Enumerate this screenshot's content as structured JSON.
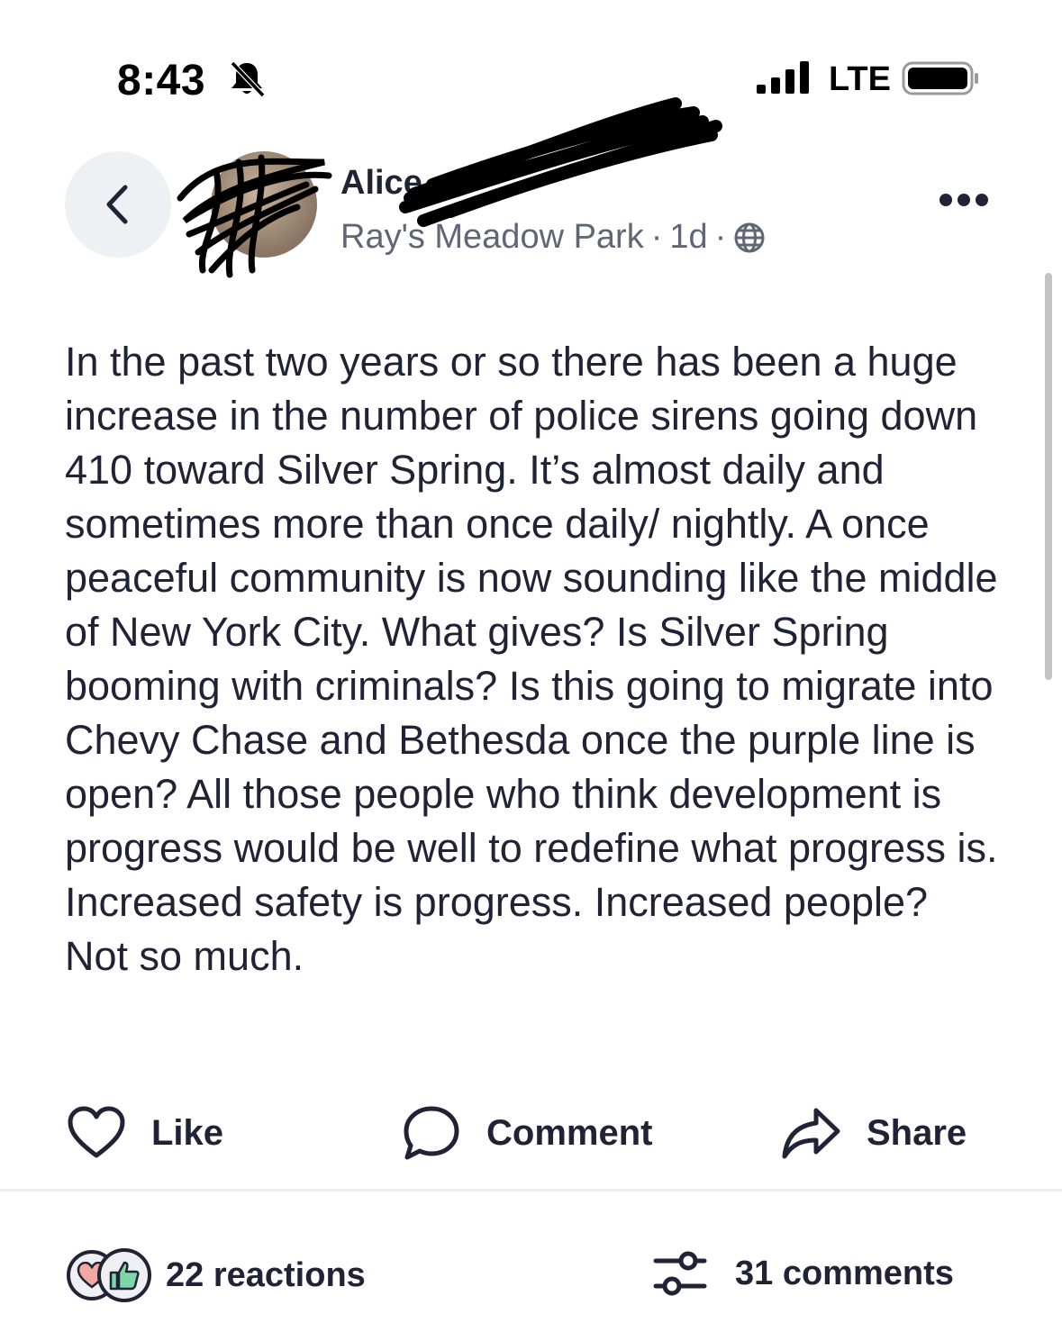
{
  "status_bar": {
    "time": "8:43",
    "network": "LTE",
    "icons": [
      "bell-slash-icon",
      "signal-icon",
      "battery-icon"
    ]
  },
  "header": {
    "author_name": "Alice",
    "location": "Ray's Meadow Park",
    "separator": "·",
    "age": "1d",
    "visibility_icon": "globe-icon",
    "back_icon": "chevron-left-icon",
    "more_icon": "more-horizontal-icon"
  },
  "post": {
    "body": "In the past two years or so there has been a huge increase in the number of police sirens going down 410 toward Silver Spring. It’s almost daily and sometimes more than once daily/ nightly. A once peaceful community is now sounding like the middle of New York City. What gives? Is Silver Spring booming with criminals? Is this going to migrate into Chevy Chase and Bethesda once the purple line is open? All those people who think development is progress would be well to redefine what progress is. Increased safety is progress. Increased people? Not so much."
  },
  "actions": {
    "like": "Like",
    "comment": "Comment",
    "share": "Share"
  },
  "footer": {
    "reactions": "22 reactions",
    "comments": "31 comments",
    "reaction_icons": [
      "heart-icon",
      "thumbs-up-icon"
    ],
    "sort_icon": "sliders-icon"
  },
  "colors": {
    "text": "#1f2335",
    "muted": "#5f6675",
    "surface": "#eef0f3",
    "heart": "#f4a8a4",
    "thumb": "#7fd6a7"
  }
}
